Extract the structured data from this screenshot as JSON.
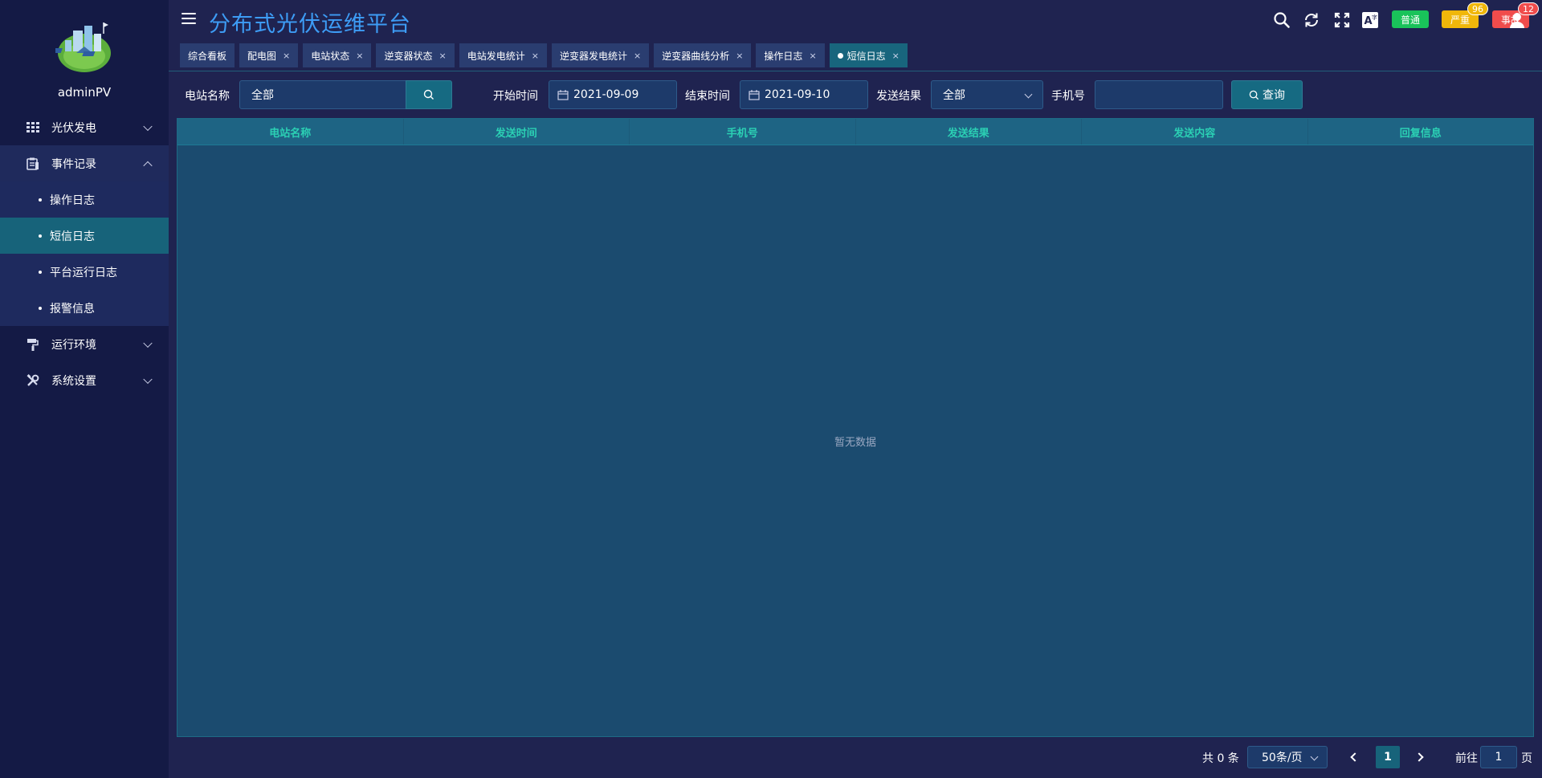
{
  "app": {
    "title": "分布式光伏运维平台",
    "username": "adminPV"
  },
  "sidebar": {
    "items": [
      {
        "label": "光伏发电",
        "icon": "grid-icon",
        "expanded": false
      },
      {
        "label": "事件记录",
        "icon": "clipboard-icon",
        "expanded": true,
        "children": [
          {
            "label": "操作日志",
            "active": false
          },
          {
            "label": "短信日志",
            "active": true
          },
          {
            "label": "平台运行日志",
            "active": false
          },
          {
            "label": "报警信息",
            "active": false
          }
        ]
      },
      {
        "label": "运行环境",
        "icon": "paint-roller-icon",
        "expanded": false
      },
      {
        "label": "系统设置",
        "icon": "tools-icon",
        "expanded": false
      }
    ]
  },
  "header": {
    "alarm_normal": "普通",
    "alarm_severe": "严重",
    "alarm_severe_count": "96",
    "alarm_fault": "事故",
    "alarm_fault_count": "12"
  },
  "tabs": [
    {
      "label": "综合看板",
      "closable": false,
      "active": false
    },
    {
      "label": "配电图",
      "closable": true,
      "active": false
    },
    {
      "label": "电站状态",
      "closable": true,
      "active": false
    },
    {
      "label": "逆变器状态",
      "closable": true,
      "active": false
    },
    {
      "label": "电站发电统计",
      "closable": true,
      "active": false
    },
    {
      "label": "逆变器发电统计",
      "closable": true,
      "active": false
    },
    {
      "label": "逆变器曲线分析",
      "closable": true,
      "active": false
    },
    {
      "label": "操作日志",
      "closable": true,
      "active": false
    },
    {
      "label": "短信日志",
      "closable": true,
      "active": true
    }
  ],
  "filters": {
    "station_label": "电站名称",
    "station_value": "全部",
    "start_label": "开始时间",
    "start_value": "2021-09-09",
    "end_label": "结束时间",
    "end_value": "2021-09-10",
    "result_label": "发送结果",
    "result_value": "全部",
    "phone_label": "手机号",
    "phone_value": "",
    "query_label": "查询"
  },
  "table": {
    "columns": [
      "电站名称",
      "发送时间",
      "手机号",
      "发送结果",
      "发送内容",
      "回复信息"
    ],
    "rows": [],
    "empty_text": "暂无数据"
  },
  "pagination": {
    "total_text": "共 0 条",
    "page_size": "50条/页",
    "current_page": "1",
    "goto_label": "前往",
    "goto_value": "1",
    "page_suffix": "页"
  },
  "colors": {
    "title": "#3d9cf5",
    "header_text": "#2bd0b4",
    "active": "#17637a"
  }
}
